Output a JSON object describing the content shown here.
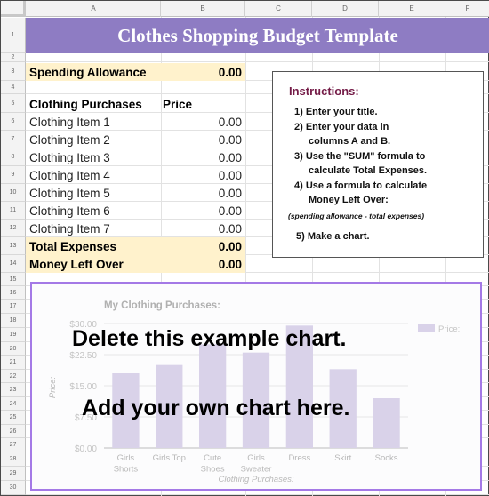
{
  "columns": [
    "A",
    "B",
    "C",
    "D",
    "E",
    "F"
  ],
  "rows": [
    "1",
    "2",
    "3",
    "4",
    "5",
    "6",
    "7",
    "8",
    "9",
    "10",
    "11",
    "12",
    "13",
    "14",
    "15",
    "16",
    "17",
    "18",
    "19",
    "20",
    "21",
    "22",
    "23",
    "24",
    "25",
    "26",
    "27",
    "28",
    "29",
    "30"
  ],
  "title": "Clothes Shopping Budget Template",
  "spending_allowance": {
    "label": "Spending Allowance",
    "value": "0.00"
  },
  "table_header": {
    "item": "Clothing Purchases",
    "price": "Price"
  },
  "items": [
    {
      "label": "Clothing Item 1",
      "value": "0.00"
    },
    {
      "label": "Clothing Item 2",
      "value": "0.00"
    },
    {
      "label": "Clothing Item 3",
      "value": "0.00"
    },
    {
      "label": "Clothing Item 4",
      "value": "0.00"
    },
    {
      "label": "Clothing Item 5",
      "value": "0.00"
    },
    {
      "label": "Clothing Item 6",
      "value": "0.00"
    },
    {
      "label": "Clothing Item 7",
      "value": "0.00"
    }
  ],
  "total_expenses": {
    "label": "Total Expenses",
    "value": "0.00"
  },
  "money_left_over": {
    "label": "Money Left Over",
    "value": "0.00"
  },
  "instructions": {
    "title": "Instructions:",
    "step1": "1) Enter your title.",
    "step2a": "2) Enter your data in",
    "step2b": "columns A and B.",
    "step3a": "3) Use the \"SUM\" formula to",
    "step3b": "calculate Total Expenses.",
    "step4a": "4) Use a formula to calculate",
    "step4b": "Money Left Over:",
    "note": "(spending allowance - total expenses)",
    "step5": "5) Make a chart."
  },
  "overlay": {
    "line1": "Delete this example chart.",
    "line2": "Add your own chart here."
  },
  "colors": {
    "title_band": "#8e7cc3",
    "highlight": "#fff2cc",
    "instructions_title": "#741b47",
    "bar": "#d9d2e9",
    "chart_border": "#a479e6"
  },
  "chart_data": {
    "type": "bar",
    "title": "My Clothing Purchases:",
    "xlabel": "Clothing Purchases:",
    "ylabel": "Price:",
    "categories": [
      [
        "Girls",
        "Shorts"
      ],
      [
        "Girls Top"
      ],
      [
        "Cute",
        "Shoes"
      ],
      [
        "Girls",
        "Sweater"
      ],
      [
        "Dress"
      ],
      [
        "Skirt"
      ],
      [
        "Socks"
      ]
    ],
    "series": [
      {
        "name": "Price:",
        "values": [
          18,
          20,
          25,
          23,
          29.5,
          19,
          12
        ]
      }
    ],
    "yticks": [
      "$0.00",
      "$7.50",
      "$15.00",
      "$22.50",
      "$30.00"
    ],
    "ylim": [
      0,
      30
    ],
    "grid": true,
    "legend": "top-right"
  }
}
